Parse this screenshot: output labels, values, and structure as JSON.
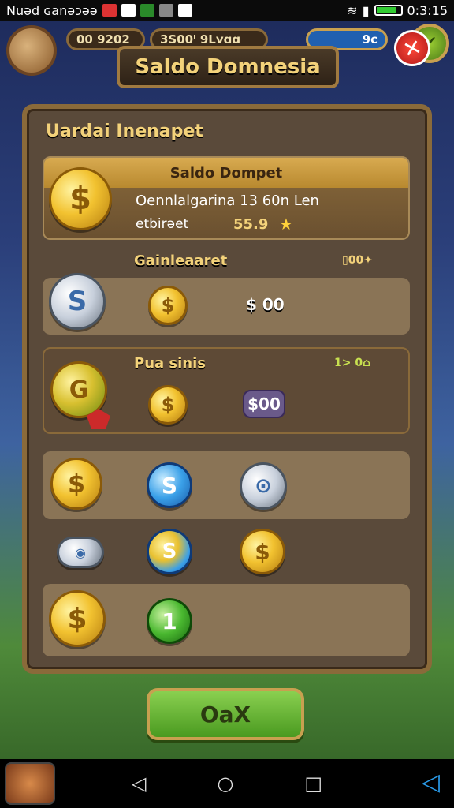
{
  "status_bar": {
    "left_text": "Nuəd ɢanəɔəə",
    "time": "0:3:15"
  },
  "hud": {
    "counter_1": "00 9202",
    "counter_2": "3S00ᴵ 9Lvɑɑ",
    "counter_3": "9c"
  },
  "title": "Saldo Domnesia",
  "panel_heading": "Uardai Inenapet",
  "wallet": {
    "header": "Saldo Dompet",
    "line1": "Oennlalgarina 13 60n Len",
    "line2_label": "etbirəet",
    "line2_amount": "55.9"
  },
  "section_1": {
    "label": "Gainleaaret",
    "badge": "▯00✦"
  },
  "row_1": {
    "amount": "$ 00"
  },
  "section_2": {
    "label": "Pua sinis",
    "badge": "1> 0⌂"
  },
  "row_2": {
    "amount": "$00"
  },
  "row_coin_green": {
    "text": "1"
  },
  "ok_button": "OaX",
  "icons": {
    "star": "star-icon",
    "close": "close-icon",
    "check": "check-icon"
  }
}
